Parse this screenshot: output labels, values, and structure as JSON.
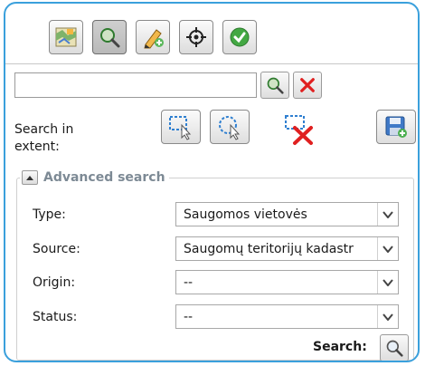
{
  "toolbar": {
    "buttons": [
      {
        "icon": "map-icon",
        "active": false
      },
      {
        "icon": "magnifier-icon",
        "active": true
      },
      {
        "icon": "pencil-add-icon",
        "active": false
      },
      {
        "icon": "crosshair-icon",
        "active": false
      },
      {
        "icon": "checkmark-icon",
        "active": false
      }
    ]
  },
  "search": {
    "value": "",
    "placeholder": ""
  },
  "extent": {
    "label": "Search in extent:"
  },
  "advanced": {
    "legend": "Advanced search",
    "fields": [
      {
        "label": "Type:",
        "value": "Saugomos vietovės"
      },
      {
        "label": "Source:",
        "value": "Saugomų teritorijų kadastr"
      },
      {
        "label": "Origin:",
        "value": "--"
      },
      {
        "label": "Status:",
        "value": "--"
      }
    ],
    "search_label": "Search:"
  },
  "colors": {
    "frame": "#3aa0dc",
    "legend_text": "#7d8a95",
    "clear_red": "#e02020",
    "select_blue": "#2f7fd0",
    "save_green": "#4caf50"
  }
}
